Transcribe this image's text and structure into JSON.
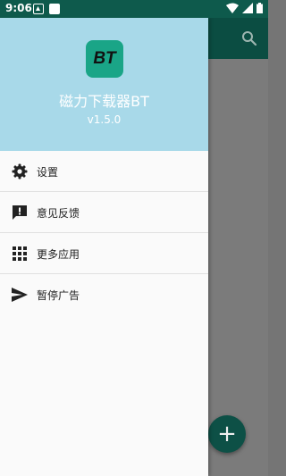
{
  "status_bar": {
    "time": "9:06"
  },
  "drawer": {
    "app_icon_text": "BT",
    "app_name": "磁力下载器BT",
    "version": "v1.5.0",
    "items": [
      {
        "label": "设置",
        "icon": "gear-icon"
      },
      {
        "label": "意见反馈",
        "icon": "feedback-icon"
      },
      {
        "label": "更多应用",
        "icon": "apps-grid-icon"
      },
      {
        "label": "暂停广告",
        "icon": "send-icon"
      }
    ]
  },
  "fab": {
    "symbol": "+"
  },
  "colors": {
    "status_bar": "#0e5a4c",
    "drawer_header": "#a8d9e9",
    "app_icon": "#1aa587",
    "fab": "#0d5046"
  }
}
